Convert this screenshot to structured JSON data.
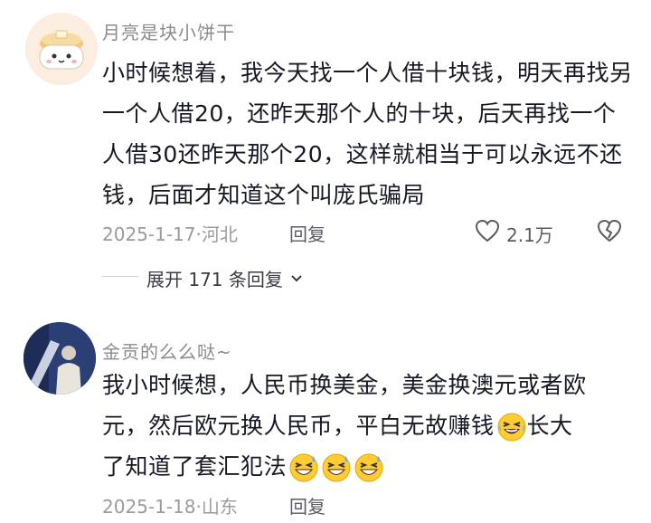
{
  "comments": [
    {
      "username": "月亮是块小饼干",
      "content": "小时候想着，我今天找一个人借十块钱，明天再找另一个人借20，还昨天那个人的十块，后天再找一个人借30还昨天那个20，这样就相当于可以永远不还钱，后面才知道这个叫庞氏骗局",
      "date": "2025-1-17",
      "location": "河北",
      "reply_label": "回复",
      "likes": "2.1万",
      "expand_label": "展开 171 条回复"
    },
    {
      "username": "金贡的么么哒~",
      "content_line1": "我小时候想，人民币换美金，美金换澳元或者欧",
      "content_line2": "元，然后欧元换人民币，平白无故赚钱",
      "content_line2_tail": "长大",
      "content_line3": "了知道了套汇犯法",
      "emoji_name": "laughing-crying-emoji",
      "date": "2025-1-18",
      "location": "山东",
      "reply_label": "回复"
    }
  ],
  "colors": {
    "text": "#161823",
    "meta": "#9a9ba1",
    "username": "#8a8b91"
  }
}
